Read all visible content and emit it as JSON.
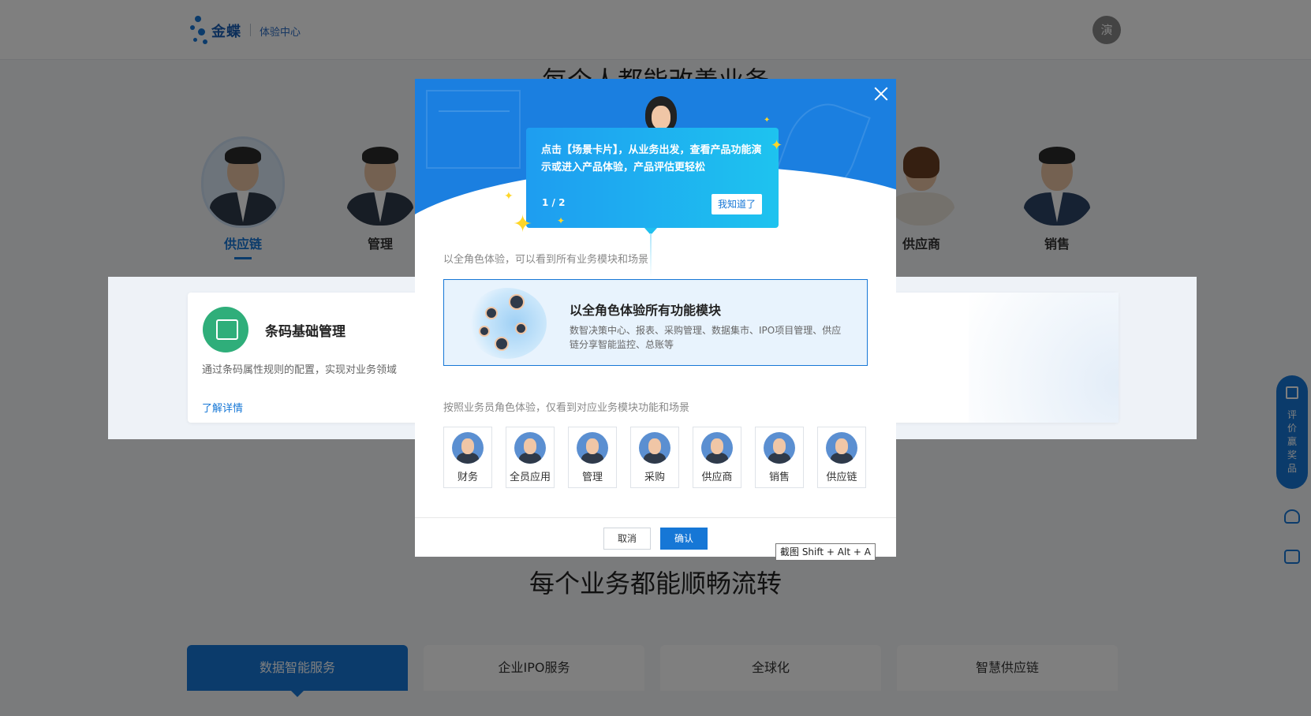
{
  "header": {
    "brand": "金蝶",
    "subtitle": "体验中心",
    "avatar_text": "演"
  },
  "hero": {
    "title": "每个人都能改善业务"
  },
  "roles": [
    {
      "label": "供应链",
      "active": true
    },
    {
      "label": "管理"
    },
    {
      "label": "供应商"
    },
    {
      "label": "销售"
    }
  ],
  "scene_card": {
    "title": "条码基础管理",
    "desc": "通过条码属性规则的配置，实现对业务领域",
    "link": "了解详情"
  },
  "flow": {
    "title": "每个业务都能顺畅流转"
  },
  "bottom_tabs": [
    {
      "label": "数据智能服务",
      "active": true
    },
    {
      "label": "企业IPO服务"
    },
    {
      "label": "全球化"
    },
    {
      "label": "智慧供应链"
    }
  ],
  "side_float": {
    "label": "评价赢奖品"
  },
  "modal": {
    "section1_label": "以全角色体验，可以看到所有业务模块和场景",
    "all_role_title": "以全角色体验所有功能模块",
    "all_role_desc": "数智决策中心、报表、采购管理、数据集市、IPO项目管理、供应链分享智能监控、总账等",
    "section2_label": "按照业务员角色体验，仅看到对应业务模块功能和场景",
    "role_chips": [
      "财务",
      "全员应用",
      "管理",
      "采购",
      "供应商",
      "销售",
      "供应链"
    ],
    "cancel_label": "取消",
    "ok_label": "确认"
  },
  "tooltip": {
    "text": "点击【场景卡片】，从业务出发，查看产品功能演示或进入产品体验，产品评估更轻松",
    "step": "1 / 2",
    "button": "我知道了"
  },
  "shortcut_hint": "截图 Shift + Alt + A",
  "colors": {
    "accent": "#1677d6",
    "tooltip_from": "#1e9df0",
    "tooltip_to": "#1ec3ef",
    "spark": "#ffd628"
  }
}
